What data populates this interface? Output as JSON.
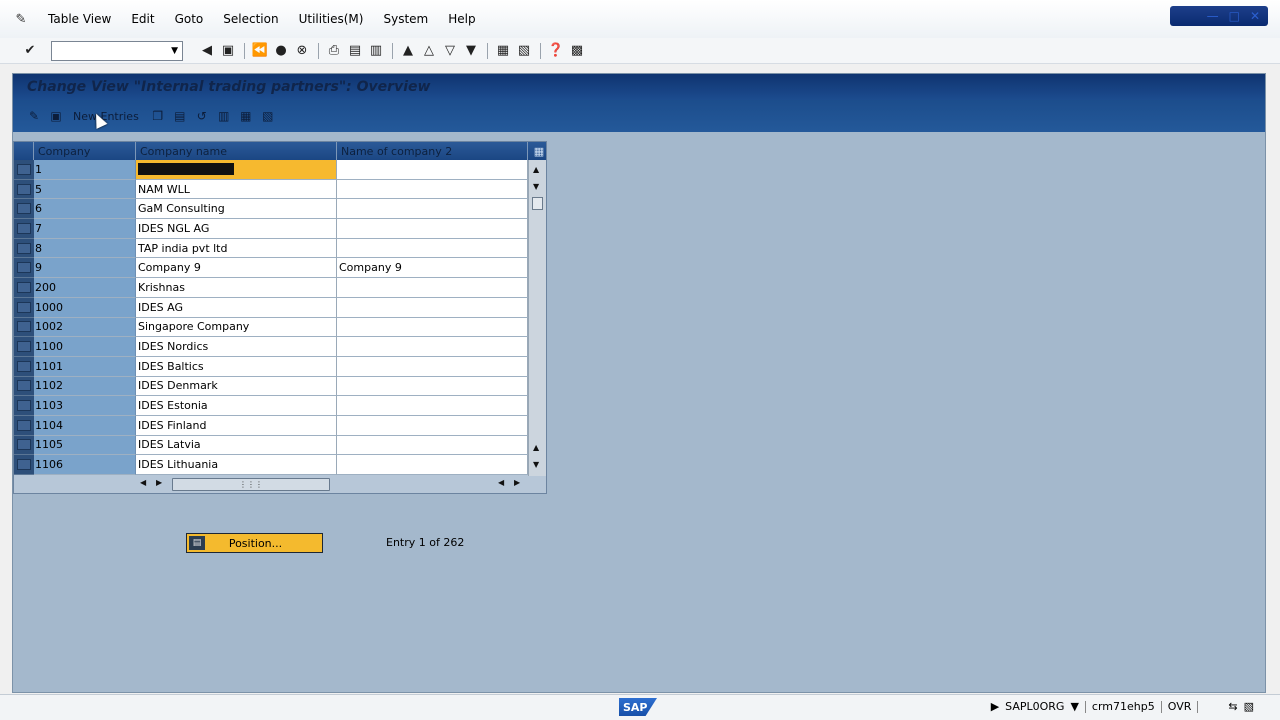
{
  "menu": {
    "items": [
      "Table View",
      "Edit",
      "Goto",
      "Selection",
      "Utilities(M)",
      "System",
      "Help"
    ]
  },
  "toolbar": {
    "command_value": ""
  },
  "screen": {
    "title": "Change View \"Internal trading partners\": Overview",
    "new_entries_label": "New Entries"
  },
  "table": {
    "headers": {
      "company": "Company",
      "company_name": "Company name",
      "name2": "Name of company 2"
    },
    "rows": [
      {
        "company": "1",
        "name": "",
        "name2": ""
      },
      {
        "company": "5",
        "name": "NAM WLL",
        "name2": ""
      },
      {
        "company": "6",
        "name": "GaM Consulting",
        "name2": ""
      },
      {
        "company": "7",
        "name": "IDES NGL AG",
        "name2": ""
      },
      {
        "company": "8",
        "name": "TAP india pvt ltd",
        "name2": ""
      },
      {
        "company": "9",
        "name": "Company 9",
        "name2": "Company 9"
      },
      {
        "company": "200",
        "name": "Krishnas",
        "name2": ""
      },
      {
        "company": "1000",
        "name": "IDES AG",
        "name2": ""
      },
      {
        "company": "1002",
        "name": "Singapore Company",
        "name2": ""
      },
      {
        "company": "1100",
        "name": "IDES Nordics",
        "name2": ""
      },
      {
        "company": "1101",
        "name": "IDES Baltics",
        "name2": ""
      },
      {
        "company": "1102",
        "name": "IDES Denmark",
        "name2": ""
      },
      {
        "company": "1103",
        "name": "IDES Estonia",
        "name2": ""
      },
      {
        "company": "1104",
        "name": "IDES Finland",
        "name2": ""
      },
      {
        "company": "1105",
        "name": "IDES Latvia",
        "name2": ""
      },
      {
        "company": "1106",
        "name": "IDES Lithuania",
        "name2": ""
      }
    ]
  },
  "footer": {
    "position_label": "Position...",
    "entry_info": "Entry 1 of 262"
  },
  "statusbar": {
    "logo": "SAP",
    "program": "SAPL0ORG",
    "server": "crm71ehp5",
    "mode": "OVR"
  }
}
